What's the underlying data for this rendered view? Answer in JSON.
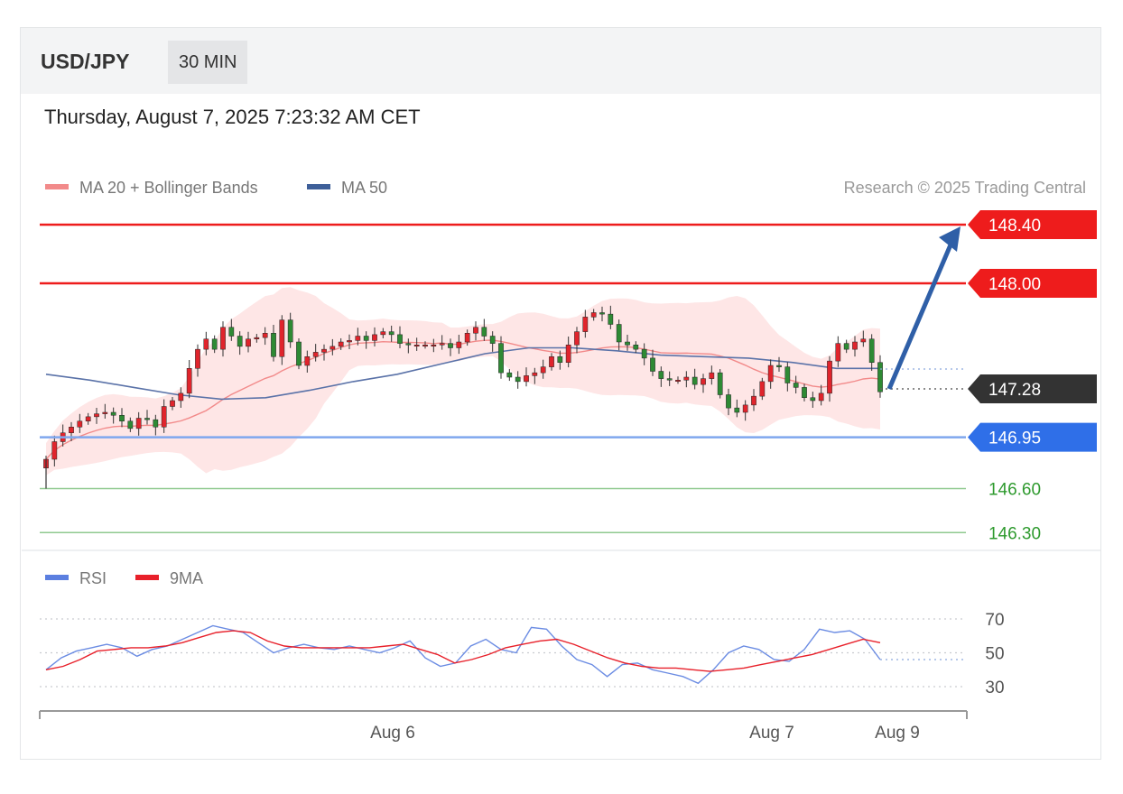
{
  "header": {
    "symbol": "USD/JPY",
    "timeframe": "30 MIN",
    "datetime": "Thursday, August 7, 2025 7:23:32 AM CET"
  },
  "legend": {
    "ma20": "MA 20 + Bollinger Bands",
    "ma50": "MA 50",
    "credit": "Research © 2025 Trading Central"
  },
  "rsi_legend": {
    "rsi": "RSI",
    "ma9": "9MA"
  },
  "colors": {
    "resistance": "#ee1c1c",
    "support1": "#2f6fe8",
    "support2": "#2e9a2e",
    "last": "#333333",
    "up_candle": "#e0242c",
    "down_candle": "#2e8a34",
    "bb_fill": "#fddddd",
    "ma20": "#f28a8a",
    "ma50": "#5a72a8",
    "rsi": "#5b7fe0",
    "rsi_ma": "#e8202a",
    "arrow": "#2f5fa7"
  },
  "chart_data": [
    {
      "type": "candlestick",
      "title": "USD/JPY",
      "timeframe": "30 MIN",
      "x_ticks": [
        "Aug 6",
        "Aug 7",
        "Aug 9"
      ],
      "levels": [
        {
          "value": 148.4,
          "label": "148.40",
          "kind": "resistance"
        },
        {
          "value": 148.0,
          "label": "148.00",
          "kind": "resistance"
        },
        {
          "value": 147.28,
          "label": "147.28",
          "kind": "last"
        },
        {
          "value": 146.95,
          "label": "146.95",
          "kind": "support"
        },
        {
          "value": 146.6,
          "label": "146.60",
          "kind": "support-minor"
        },
        {
          "value": 146.3,
          "label": "146.30",
          "kind": "support-minor"
        }
      ],
      "ylim": [
        146.25,
        148.52
      ],
      "series": [
        {
          "name": "MA 20 + Bollinger Bands",
          "kind": "band"
        },
        {
          "name": "MA 50",
          "kind": "line",
          "values": [
            147.38,
            147.34,
            147.29,
            147.24,
            147.21,
            147.22,
            147.27,
            147.33,
            147.38,
            147.45,
            147.52,
            147.56,
            147.56,
            147.54,
            147.51,
            147.5,
            147.49,
            147.46,
            147.42,
            147.42
          ]
        }
      ],
      "closes": [
        146.8,
        146.92,
        146.98,
        147.02,
        147.06,
        147.09,
        147.11,
        147.12,
        147.1,
        147.06,
        147.01,
        147.08,
        147.07,
        147.02,
        147.16,
        147.2,
        147.25,
        147.42,
        147.55,
        147.62,
        147.55,
        147.7,
        147.64,
        147.57,
        147.62,
        147.63,
        147.66,
        147.5,
        147.75,
        147.6,
        147.44,
        147.5,
        147.53,
        147.55,
        147.57,
        147.6,
        147.61,
        147.64,
        147.61,
        147.65,
        147.67,
        147.65,
        147.59,
        147.58,
        147.58,
        147.58,
        147.58,
        147.59,
        147.56,
        147.6,
        147.66,
        147.7,
        147.64,
        147.59,
        147.39,
        147.36,
        147.33,
        147.37,
        147.39,
        147.43,
        147.5,
        147.46,
        147.58,
        147.67,
        147.77,
        147.8,
        147.79,
        147.72,
        147.6,
        147.58,
        147.55,
        147.49,
        147.4,
        147.35,
        147.34,
        147.34,
        147.36,
        147.31,
        147.35,
        147.39,
        147.24,
        147.15,
        147.12,
        147.17,
        147.23,
        147.33,
        147.44,
        147.43,
        147.32,
        147.29,
        147.22,
        147.2,
        147.25,
        147.47,
        147.59,
        147.55,
        147.6,
        147.62,
        147.46,
        147.26
      ],
      "rsi": {
        "ylim": [
          20,
          80
        ],
        "ticks": [
          70,
          50,
          30
        ],
        "values": [
          40,
          47,
          51,
          53,
          55,
          53,
          48,
          52,
          54,
          58,
          62,
          66,
          64,
          62,
          56,
          50,
          53,
          55,
          53,
          52,
          54,
          52,
          50,
          53,
          57,
          47,
          42,
          44,
          54,
          58,
          52,
          50,
          65,
          64,
          54,
          46,
          43,
          36,
          43,
          44,
          40,
          38,
          36,
          32,
          40,
          50,
          54,
          52,
          46,
          45,
          52,
          64,
          62,
          63,
          58,
          46
        ],
        "ma9": [
          40,
          42,
          46,
          51,
          52,
          53,
          53,
          54,
          56,
          59,
          62,
          63,
          62,
          57,
          54,
          53,
          53,
          53,
          53,
          53,
          54,
          55,
          52,
          49,
          44,
          46,
          49,
          53,
          55,
          57,
          58,
          55,
          51,
          47,
          44,
          42,
          41,
          41,
          40,
          39,
          40,
          41,
          43,
          45,
          47,
          49,
          52,
          55,
          58,
          56
        ]
      }
    }
  ]
}
